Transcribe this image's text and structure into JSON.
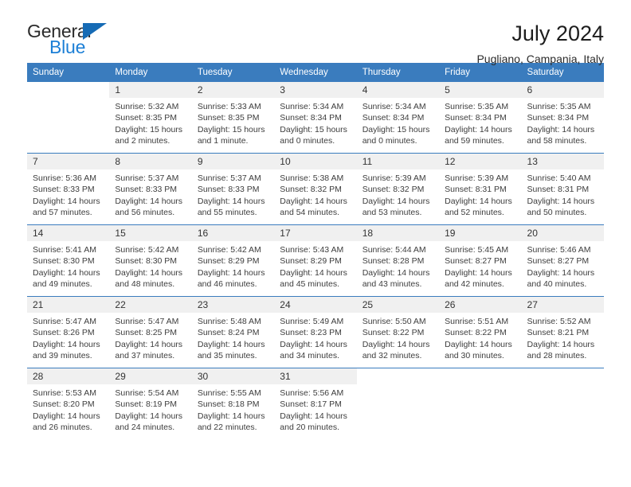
{
  "brand": {
    "name_dark": "General",
    "name_blue": "Blue",
    "accent_color": "#166bb5",
    "blue_text_color": "#1c7fd6"
  },
  "header": {
    "title": "July 2024",
    "subtitle": "Pugliano, Campania, Italy",
    "header_bg": "#3a7cbe",
    "header_text_color": "#ffffff"
  },
  "calendar": {
    "weekday_headers": [
      "Sunday",
      "Monday",
      "Tuesday",
      "Wednesday",
      "Thursday",
      "Friday",
      "Saturday"
    ],
    "labels": {
      "sunrise": "Sunrise:",
      "sunset": "Sunset:",
      "daylight": "Daylight:"
    },
    "weeks": [
      [
        {
          "day": "",
          "lines": []
        },
        {
          "day": "1",
          "lines": [
            "Sunrise: 5:32 AM",
            "Sunset: 8:35 PM",
            "Daylight: 15 hours",
            "and 2 minutes."
          ]
        },
        {
          "day": "2",
          "lines": [
            "Sunrise: 5:33 AM",
            "Sunset: 8:35 PM",
            "Daylight: 15 hours",
            "and 1 minute."
          ]
        },
        {
          "day": "3",
          "lines": [
            "Sunrise: 5:34 AM",
            "Sunset: 8:34 PM",
            "Daylight: 15 hours",
            "and 0 minutes."
          ]
        },
        {
          "day": "4",
          "lines": [
            "Sunrise: 5:34 AM",
            "Sunset: 8:34 PM",
            "Daylight: 15 hours",
            "and 0 minutes."
          ]
        },
        {
          "day": "5",
          "lines": [
            "Sunrise: 5:35 AM",
            "Sunset: 8:34 PM",
            "Daylight: 14 hours",
            "and 59 minutes."
          ]
        },
        {
          "day": "6",
          "lines": [
            "Sunrise: 5:35 AM",
            "Sunset: 8:34 PM",
            "Daylight: 14 hours",
            "and 58 minutes."
          ]
        }
      ],
      [
        {
          "day": "7",
          "lines": [
            "Sunrise: 5:36 AM",
            "Sunset: 8:33 PM",
            "Daylight: 14 hours",
            "and 57 minutes."
          ]
        },
        {
          "day": "8",
          "lines": [
            "Sunrise: 5:37 AM",
            "Sunset: 8:33 PM",
            "Daylight: 14 hours",
            "and 56 minutes."
          ]
        },
        {
          "day": "9",
          "lines": [
            "Sunrise: 5:37 AM",
            "Sunset: 8:33 PM",
            "Daylight: 14 hours",
            "and 55 minutes."
          ]
        },
        {
          "day": "10",
          "lines": [
            "Sunrise: 5:38 AM",
            "Sunset: 8:32 PM",
            "Daylight: 14 hours",
            "and 54 minutes."
          ]
        },
        {
          "day": "11",
          "lines": [
            "Sunrise: 5:39 AM",
            "Sunset: 8:32 PM",
            "Daylight: 14 hours",
            "and 53 minutes."
          ]
        },
        {
          "day": "12",
          "lines": [
            "Sunrise: 5:39 AM",
            "Sunset: 8:31 PM",
            "Daylight: 14 hours",
            "and 52 minutes."
          ]
        },
        {
          "day": "13",
          "lines": [
            "Sunrise: 5:40 AM",
            "Sunset: 8:31 PM",
            "Daylight: 14 hours",
            "and 50 minutes."
          ]
        }
      ],
      [
        {
          "day": "14",
          "lines": [
            "Sunrise: 5:41 AM",
            "Sunset: 8:30 PM",
            "Daylight: 14 hours",
            "and 49 minutes."
          ]
        },
        {
          "day": "15",
          "lines": [
            "Sunrise: 5:42 AM",
            "Sunset: 8:30 PM",
            "Daylight: 14 hours",
            "and 48 minutes."
          ]
        },
        {
          "day": "16",
          "lines": [
            "Sunrise: 5:42 AM",
            "Sunset: 8:29 PM",
            "Daylight: 14 hours",
            "and 46 minutes."
          ]
        },
        {
          "day": "17",
          "lines": [
            "Sunrise: 5:43 AM",
            "Sunset: 8:29 PM",
            "Daylight: 14 hours",
            "and 45 minutes."
          ]
        },
        {
          "day": "18",
          "lines": [
            "Sunrise: 5:44 AM",
            "Sunset: 8:28 PM",
            "Daylight: 14 hours",
            "and 43 minutes."
          ]
        },
        {
          "day": "19",
          "lines": [
            "Sunrise: 5:45 AM",
            "Sunset: 8:27 PM",
            "Daylight: 14 hours",
            "and 42 minutes."
          ]
        },
        {
          "day": "20",
          "lines": [
            "Sunrise: 5:46 AM",
            "Sunset: 8:27 PM",
            "Daylight: 14 hours",
            "and 40 minutes."
          ]
        }
      ],
      [
        {
          "day": "21",
          "lines": [
            "Sunrise: 5:47 AM",
            "Sunset: 8:26 PM",
            "Daylight: 14 hours",
            "and 39 minutes."
          ]
        },
        {
          "day": "22",
          "lines": [
            "Sunrise: 5:47 AM",
            "Sunset: 8:25 PM",
            "Daylight: 14 hours",
            "and 37 minutes."
          ]
        },
        {
          "day": "23",
          "lines": [
            "Sunrise: 5:48 AM",
            "Sunset: 8:24 PM",
            "Daylight: 14 hours",
            "and 35 minutes."
          ]
        },
        {
          "day": "24",
          "lines": [
            "Sunrise: 5:49 AM",
            "Sunset: 8:23 PM",
            "Daylight: 14 hours",
            "and 34 minutes."
          ]
        },
        {
          "day": "25",
          "lines": [
            "Sunrise: 5:50 AM",
            "Sunset: 8:22 PM",
            "Daylight: 14 hours",
            "and 32 minutes."
          ]
        },
        {
          "day": "26",
          "lines": [
            "Sunrise: 5:51 AM",
            "Sunset: 8:22 PM",
            "Daylight: 14 hours",
            "and 30 minutes."
          ]
        },
        {
          "day": "27",
          "lines": [
            "Sunrise: 5:52 AM",
            "Sunset: 8:21 PM",
            "Daylight: 14 hours",
            "and 28 minutes."
          ]
        }
      ],
      [
        {
          "day": "28",
          "lines": [
            "Sunrise: 5:53 AM",
            "Sunset: 8:20 PM",
            "Daylight: 14 hours",
            "and 26 minutes."
          ]
        },
        {
          "day": "29",
          "lines": [
            "Sunrise: 5:54 AM",
            "Sunset: 8:19 PM",
            "Daylight: 14 hours",
            "and 24 minutes."
          ]
        },
        {
          "day": "30",
          "lines": [
            "Sunrise: 5:55 AM",
            "Sunset: 8:18 PM",
            "Daylight: 14 hours",
            "and 22 minutes."
          ]
        },
        {
          "day": "31",
          "lines": [
            "Sunrise: 5:56 AM",
            "Sunset: 8:17 PM",
            "Daylight: 14 hours",
            "and 20 minutes."
          ]
        },
        {
          "day": "",
          "lines": []
        },
        {
          "day": "",
          "lines": []
        },
        {
          "day": "",
          "lines": []
        }
      ]
    ]
  }
}
